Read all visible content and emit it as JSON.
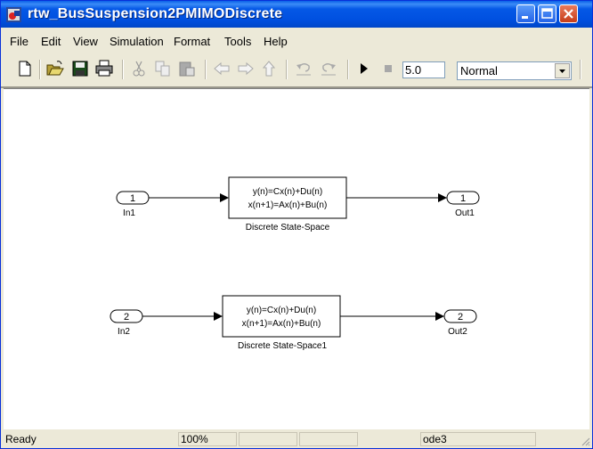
{
  "window": {
    "title": "rtw_BusSuspension2PMIMODiscrete",
    "caption_buttons": [
      "minimize",
      "maximize",
      "close"
    ]
  },
  "menubar": {
    "items": [
      "File",
      "Edit",
      "View",
      "Simulation",
      "Format",
      "Tools",
      "Help"
    ]
  },
  "toolbar": {
    "icons": [
      "new-icon",
      "open-icon",
      "save-icon",
      "print-icon",
      "cut-icon",
      "copy-icon",
      "paste-icon",
      "back-icon",
      "forward-icon",
      "up-icon",
      "undo-icon",
      "redo-icon",
      "play-icon",
      "stop-icon"
    ],
    "stop_time": "5.0",
    "sim_mode": "Normal"
  },
  "diagram": {
    "blocks": [
      {
        "type": "inport",
        "number": "1",
        "label": "In1"
      },
      {
        "type": "state-space",
        "line1": "y(n)=Cx(n)+Du(n)",
        "line2": "x(n+1)=Ax(n)+Bu(n)",
        "label": "Discrete State-Space"
      },
      {
        "type": "outport",
        "number": "1",
        "label": "Out1"
      },
      {
        "type": "inport",
        "number": "2",
        "label": "In2"
      },
      {
        "type": "state-space",
        "line1": "y(n)=Cx(n)+Du(n)",
        "line2": "x(n+1)=Ax(n)+Bu(n)",
        "label": "Discrete State-Space1"
      },
      {
        "type": "outport",
        "number": "2",
        "label": "Out2"
      }
    ]
  },
  "statusbar": {
    "status": "Ready",
    "zoom": "100%",
    "cell3": "",
    "cell4": "",
    "solver": "ode3"
  }
}
